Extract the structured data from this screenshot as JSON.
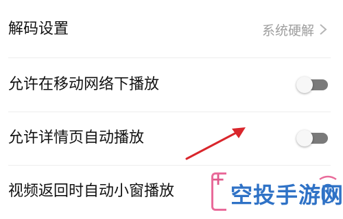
{
  "settings": [
    {
      "label": "解码设置",
      "value": "系统硬解",
      "type": "select"
    },
    {
      "label": "允许在移动网络下播放",
      "type": "toggle",
      "on": false
    },
    {
      "label": "允许详情页自动播放",
      "type": "toggle",
      "on": false
    },
    {
      "label": "视频返回时自动小窗播放",
      "type": "toggle",
      "on": false
    }
  ],
  "icons": {
    "chevron": "chevron-right-icon",
    "annotation": "red-arrow-annotation"
  },
  "colors": {
    "toggle_track": "#7a7a7a",
    "toggle_knob": "#f7f7f7",
    "secondary_text": "#9e9e9e",
    "arrow": "#d9262c",
    "watermark_blue": "#2f72c6",
    "watermark_pink": "#e96b9a"
  },
  "watermark": {
    "text": "空投手游网"
  }
}
